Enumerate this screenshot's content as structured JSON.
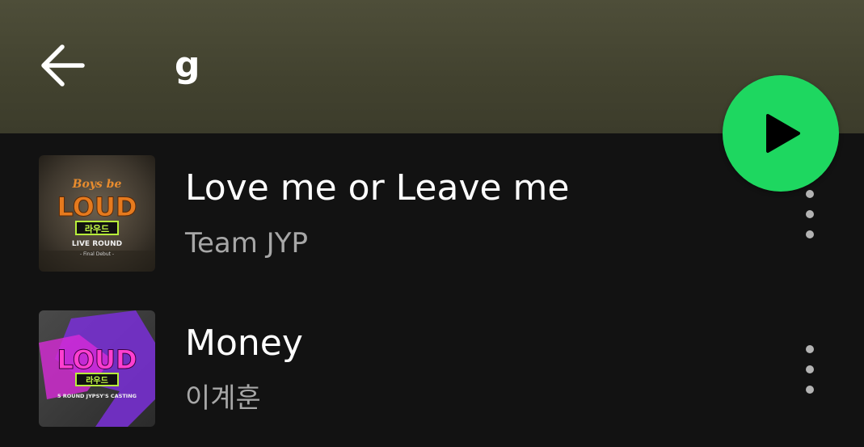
{
  "header": {
    "title": "g",
    "back_icon": "arrow-left-icon",
    "background_color": "#4a4a35"
  },
  "play_button": {
    "icon": "play-icon",
    "color": "#1ed760"
  },
  "tracks": [
    {
      "title": "Love me or Leave me",
      "artist": "Team JYP",
      "art": {
        "brand_top": "Boys be",
        "logo": "LOUD",
        "logo_sub": "라우드",
        "line1": "LIVE ROUND",
        "line2": "- Final Debut -"
      },
      "more_icon": "more-vertical-icon"
    },
    {
      "title": "Money",
      "artist": "이계훈",
      "art": {
        "logo": "LOUD",
        "logo_sub": "라우드",
        "line1": "5 ROUND JYPSY'S CASTING"
      },
      "more_icon": "more-vertical-icon"
    }
  ]
}
